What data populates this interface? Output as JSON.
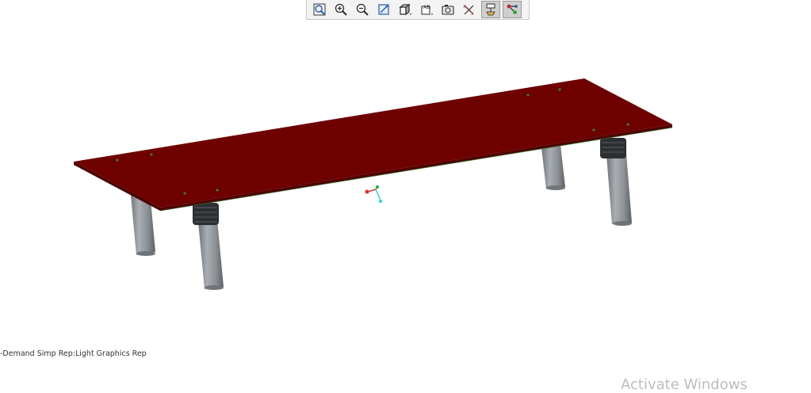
{
  "toolbar": {
    "buttons": [
      {
        "name": "refit-icon",
        "tooltip": "Refit"
      },
      {
        "name": "zoom-in-icon",
        "tooltip": "Zoom In"
      },
      {
        "name": "zoom-out-icon",
        "tooltip": "Zoom Out"
      },
      {
        "name": "repaint-icon",
        "tooltip": "Repaint"
      },
      {
        "name": "display-style-icon",
        "tooltip": "Display Style"
      },
      {
        "name": "saved-orientations-icon",
        "tooltip": "Saved Orientations"
      },
      {
        "name": "view-manager-icon",
        "tooltip": "View Manager"
      },
      {
        "name": "datum-display-icon",
        "tooltip": "Datum Display Filters"
      },
      {
        "name": "annotation-display-icon",
        "tooltip": "Annotation Display",
        "active": true
      },
      {
        "name": "spin-center-icon",
        "tooltip": "Spin Center",
        "active": true
      }
    ]
  },
  "status": {
    "simp_rep": "-Demand Simp Rep:Light Graphics Rep"
  },
  "watermark": {
    "text": "Activate Windows"
  },
  "colors": {
    "plate_top": "#6e0000",
    "plate_edge": "#4a0000",
    "leg": "#8a8f94",
    "foot": "#2c2f31",
    "background": "#ffffff"
  }
}
